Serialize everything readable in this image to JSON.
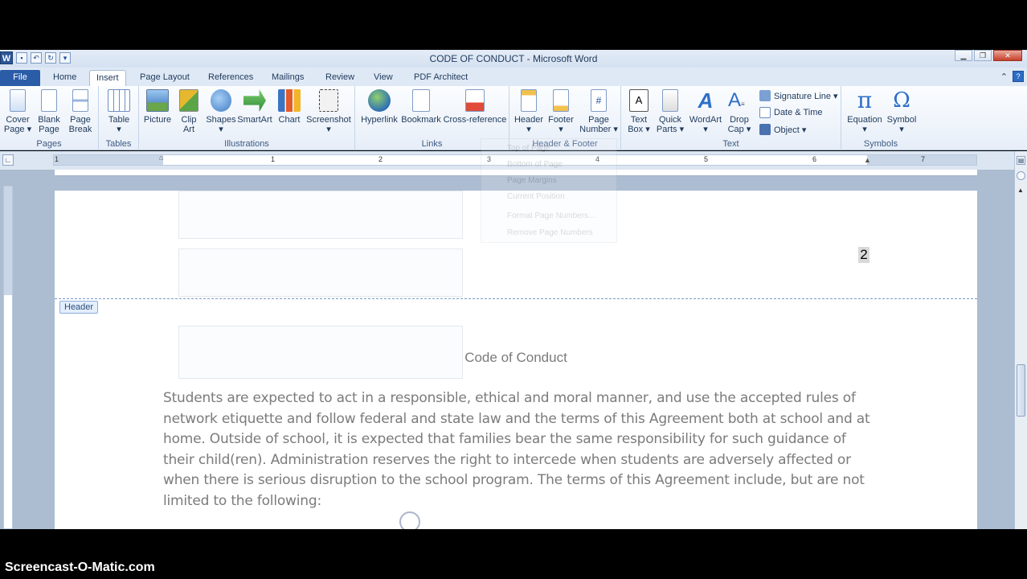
{
  "window": {
    "title": "CODE OF CONDUCT  -  Microsoft Word",
    "app_logo": "W"
  },
  "tabs": [
    "File",
    "Home",
    "Insert",
    "Page Layout",
    "References",
    "Mailings",
    "Review",
    "View",
    "PDF Architect"
  ],
  "active_tab": "Insert",
  "ribbon": {
    "pages": {
      "label": "Pages",
      "items": [
        {
          "line1": "Cover",
          "line2": "Page ▾",
          "icon": "cover-page-icon"
        },
        {
          "line1": "Blank",
          "line2": "Page",
          "icon": "blank-page-icon"
        },
        {
          "line1": "Page",
          "line2": "Break",
          "icon": "page-break-icon"
        }
      ]
    },
    "tables": {
      "label": "Tables",
      "items": [
        {
          "line1": "Table",
          "line2": "▾",
          "icon": "table-icon"
        }
      ]
    },
    "illustrations": {
      "label": "Illustrations",
      "items": [
        {
          "line1": "Picture",
          "line2": "",
          "icon": "picture-icon"
        },
        {
          "line1": "Clip",
          "line2": "Art",
          "icon": "clip-art-icon"
        },
        {
          "line1": "Shapes",
          "line2": "▾",
          "icon": "shapes-icon"
        },
        {
          "line1": "SmartArt",
          "line2": "",
          "icon": "smartart-icon"
        },
        {
          "line1": "Chart",
          "line2": "",
          "icon": "chart-icon"
        },
        {
          "line1": "Screenshot",
          "line2": "▾",
          "icon": "screenshot-icon"
        }
      ]
    },
    "links": {
      "label": "Links",
      "items": [
        {
          "line1": "Hyperlink",
          "line2": "",
          "icon": "hyperlink-icon"
        },
        {
          "line1": "Bookmark",
          "line2": "",
          "icon": "bookmark-icon"
        },
        {
          "line1": "Cross-reference",
          "line2": "",
          "icon": "cross-reference-icon"
        }
      ]
    },
    "header_footer": {
      "label": "Header & Footer",
      "items": [
        {
          "line1": "Header",
          "line2": "▾",
          "icon": "header-icon"
        },
        {
          "line1": "Footer",
          "line2": "▾",
          "icon": "footer-icon"
        },
        {
          "line1": "Page",
          "line2": "Number ▾",
          "icon": "page-number-icon"
        }
      ]
    },
    "text": {
      "label": "Text",
      "items": [
        {
          "line1": "Text",
          "line2": "Box ▾",
          "icon": "text-box-icon"
        },
        {
          "line1": "Quick",
          "line2": "Parts ▾",
          "icon": "quick-parts-icon"
        },
        {
          "line1": "WordArt",
          "line2": "▾",
          "icon": "wordart-icon"
        },
        {
          "line1": "Drop",
          "line2": "Cap ▾",
          "icon": "drop-cap-icon"
        }
      ],
      "small": [
        "Signature Line ▾",
        "Date & Time",
        "Object ▾"
      ]
    },
    "symbols": {
      "label": "Symbols",
      "items": [
        {
          "line1": "Equation",
          "line2": "▾",
          "icon": "equation-icon"
        },
        {
          "line1": "Symbol",
          "line2": "▾",
          "icon": "symbol-icon"
        }
      ]
    }
  },
  "ghost_menu": [
    "Top of Page",
    "Bottom of Page",
    "Page Margins",
    "Current Position",
    "Format Page Numbers...",
    "Remove Page Numbers"
  ],
  "ruler": {
    "numbers": [
      "1",
      "1",
      "2",
      "3",
      "4",
      "5",
      "6",
      "7"
    ]
  },
  "document": {
    "page_number": "2",
    "header_tag": "Header",
    "heading": "Code of Conduct",
    "body": "Students are expected to act in a responsible, ethical and moral manner, and use the accepted rules of network etiquette and follow federal and state law and the terms of this Agreement both at school and at home. Outside of school, it is expected that families bear the same responsibility for such guidance of their child(ren). Administration reserves the right to intercede when students are adversely affected or when there is serious disruption to the school program. The terms of this Agreement include, but are not limited to the following:"
  },
  "watermark": "Screencast-O-Matic.com",
  "colors": {
    "file_tab": "#2a5ca8",
    "ribbon_bg": "#e7eef8",
    "workspace": "#acbcd1",
    "body_text": "#7b7b7b"
  }
}
